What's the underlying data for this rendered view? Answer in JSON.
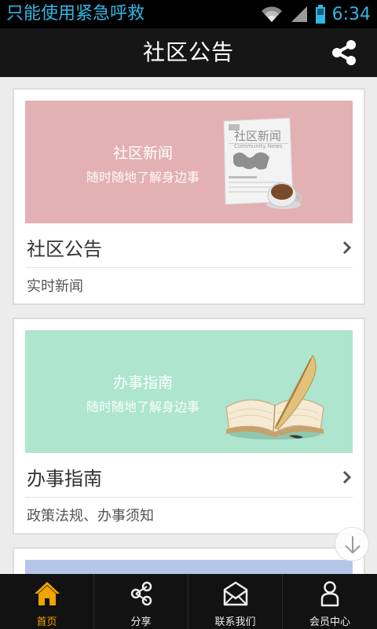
{
  "status_bar": {
    "emergency_text": "只能使用紧急呼救",
    "time": "6:34",
    "icons": [
      "wifi-icon",
      "signal-icon",
      "battery-icon"
    ]
  },
  "header": {
    "title": "社区公告",
    "share_icon": "share-icon"
  },
  "cards": [
    {
      "banner_title": "社区新闻",
      "banner_subtitle": "随时随地了解身边事",
      "banner_color": "#e3b0b3",
      "newspaper_title": "社区新闻",
      "newspaper_small": "Community News",
      "title": "社区公告",
      "subtitle": "实时新闻"
    },
    {
      "banner_title": "办事指南",
      "banner_subtitle": "随时随地了解身边事",
      "banner_color": "#ade5cf",
      "title": "办事指南",
      "subtitle": "政策法规、办事须知"
    },
    {
      "banner_color": "#b5c6e8"
    }
  ],
  "bottom_nav": [
    {
      "label": "首页",
      "icon": "home-icon",
      "active": true
    },
    {
      "label": "分享",
      "icon": "share-icon",
      "active": false
    },
    {
      "label": "联系我们",
      "icon": "mail-icon",
      "active": false
    },
    {
      "label": "会员中心",
      "icon": "user-icon",
      "active": false
    }
  ],
  "colors": {
    "accent": "#f0a400",
    "status_text": "#33b5e5",
    "header_bg": "#161616"
  }
}
